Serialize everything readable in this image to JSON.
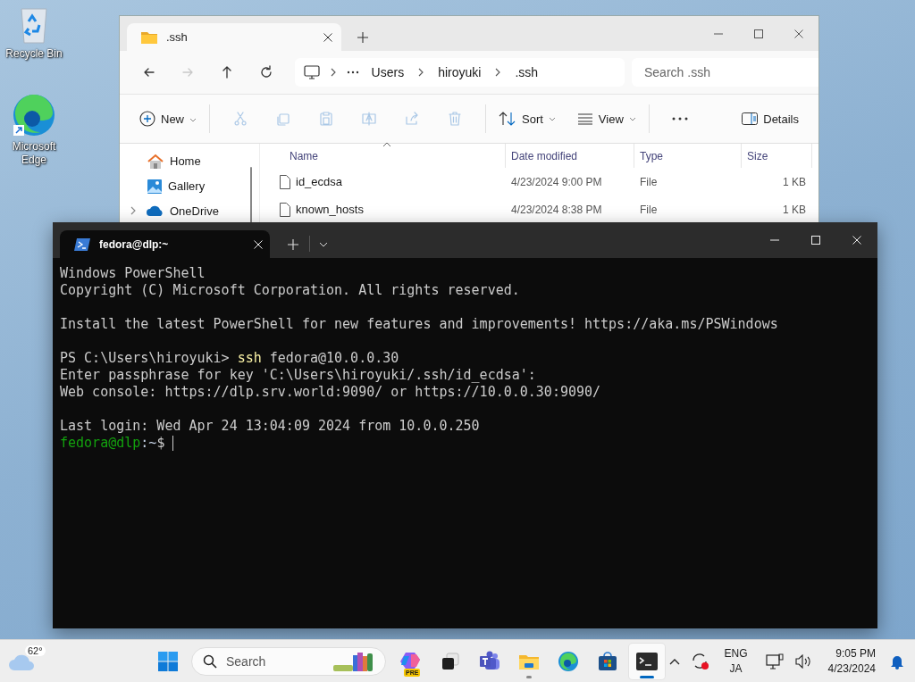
{
  "desktop_icons": [
    {
      "label": "Recycle Bin"
    },
    {
      "label": "Microsoft Edge"
    }
  ],
  "explorer": {
    "tab": {
      "title": ".ssh"
    },
    "nav": [
      {
        "disabled": false
      },
      {
        "disabled": true
      },
      {
        "disabled": false
      },
      {
        "disabled": false
      }
    ],
    "breadcrumb": [
      "Users",
      "hiroyuki",
      ".ssh"
    ],
    "search": {
      "placeholder": "Search .ssh"
    },
    "toolbar": {
      "new": "New",
      "actions": [
        {
          "disabled": true
        },
        {
          "disabled": true
        },
        {
          "disabled": true
        },
        {
          "disabled": true
        },
        {
          "disabled": true
        },
        {
          "disabled": true
        }
      ],
      "sort": "Sort",
      "view": "View",
      "details": "Details"
    },
    "sidebar": {
      "items": [
        {
          "label": "Home",
          "expandable": false
        },
        {
          "label": "Gallery",
          "expandable": false
        },
        {
          "label": "OneDrive",
          "expandable": true
        }
      ]
    },
    "columns": [
      {
        "label": "Name",
        "sorted": true
      },
      {
        "label": "Date modified",
        "sorted": false
      },
      {
        "label": "Type",
        "sorted": false
      },
      {
        "label": "Size",
        "sorted": false
      }
    ],
    "rows": [
      {
        "name": "id_ecdsa",
        "date": "4/23/2024 9:00 PM",
        "type": "File",
        "size": "1 KB"
      },
      {
        "name": "known_hosts",
        "date": "4/23/2024 8:38 PM",
        "type": "File",
        "size": "1 KB"
      }
    ]
  },
  "terminal": {
    "tab": {
      "title": "fedora@dlp:~"
    },
    "lines": [
      {
        "spaced": false,
        "cursor": false,
        "segments": [
          {
            "kind": "plain",
            "text": "Windows PowerShell"
          }
        ]
      },
      {
        "spaced": false,
        "cursor": false,
        "segments": [
          {
            "kind": "plain",
            "text": "Copyright (C) Microsoft Corporation. All rights reserved."
          }
        ]
      },
      {
        "spaced": true,
        "cursor": false,
        "segments": [
          {
            "kind": "plain",
            "text": "Install the latest PowerShell for new features and improvements! https://aka.ms/PSWindows"
          }
        ]
      },
      {
        "spaced": true,
        "cursor": false,
        "segments": [
          {
            "kind": "plain",
            "text": "PS C:\\Users\\hiroyuki> "
          },
          {
            "kind": "command",
            "text": "ssh"
          },
          {
            "kind": "plain",
            "text": " fedora@10.0.0.30"
          }
        ]
      },
      {
        "spaced": false,
        "cursor": false,
        "segments": [
          {
            "kind": "plain",
            "text": "Enter passphrase for key 'C:\\Users\\hiroyuki/.ssh/id_ecdsa':"
          }
        ]
      },
      {
        "spaced": false,
        "cursor": false,
        "segments": [
          {
            "kind": "plain",
            "text": "Web console: https://dlp.srv.world:9090/ or https://10.0.0.30:9090/"
          }
        ]
      },
      {
        "spaced": true,
        "cursor": false,
        "segments": [
          {
            "kind": "plain",
            "text": "Last login: Wed Apr 24 13:04:09 2024 from 10.0.0.250"
          }
        ]
      },
      {
        "spaced": false,
        "cursor": true,
        "segments": [
          {
            "kind": "user",
            "text": "fedora@dlp"
          },
          {
            "kind": "path",
            "text": ":~"
          },
          {
            "kind": "plain",
            "text": "$ "
          }
        ]
      }
    ]
  },
  "taskbar": {
    "weather": {
      "temperature": "62°"
    },
    "search": {
      "placeholder": "Search"
    },
    "apps": [
      {
        "running": false,
        "selected": false,
        "badge": "PRE"
      },
      {
        "running": false,
        "selected": false
      },
      {
        "running": false,
        "selected": false
      },
      {
        "running": true,
        "selected": false
      },
      {
        "running": false,
        "selected": false
      },
      {
        "running": false,
        "selected": false
      },
      {
        "running": true,
        "selected": true
      }
    ],
    "tray": {
      "language": "ENG",
      "input": "JA",
      "time": "9:05 PM",
      "date": "4/23/2024"
    }
  }
}
